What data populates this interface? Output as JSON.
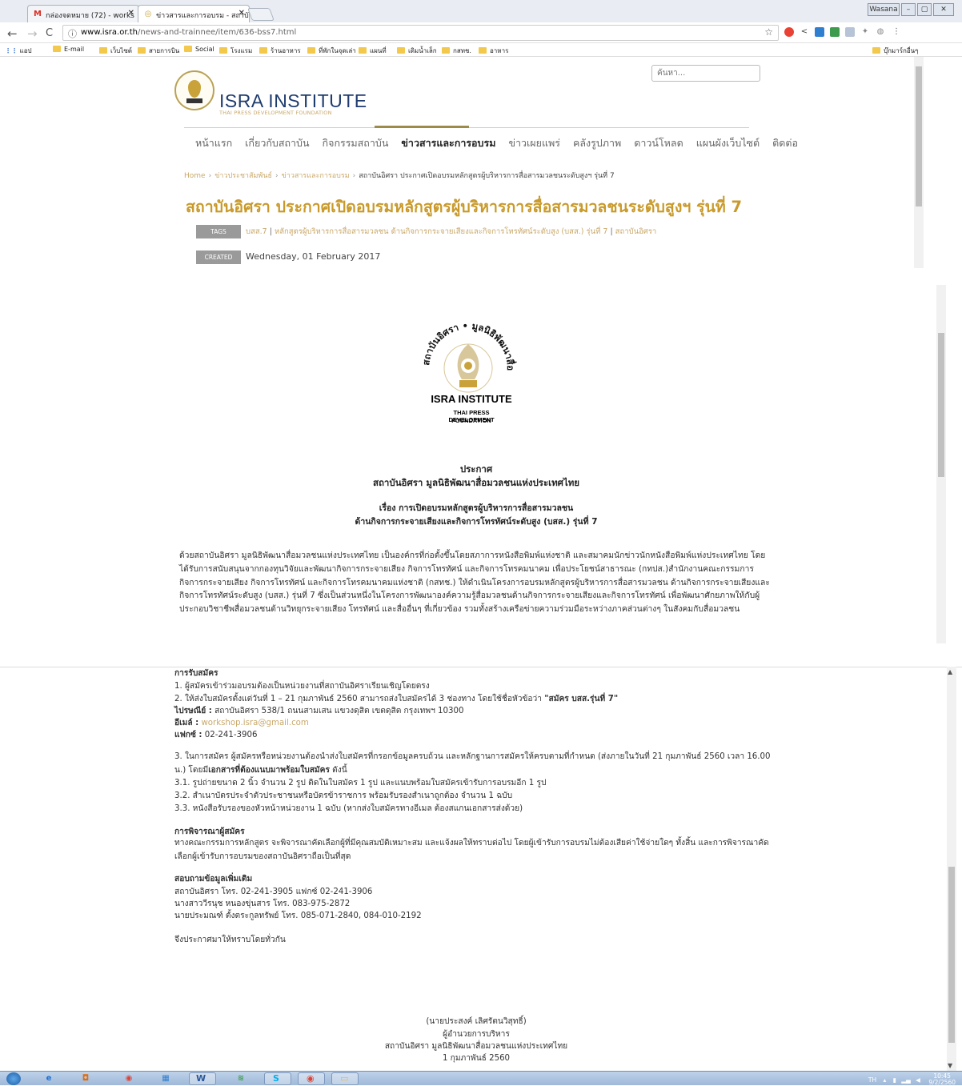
{
  "browser": {
    "tabs": [
      {
        "label": "กล่องจดหมาย (72) - works",
        "icon": "gmail-icon"
      },
      {
        "label": "ข่าวสารและการอบรม - สถาบั",
        "icon": "isra-favicon-icon"
      }
    ],
    "window_buttons": [
      "Wasana",
      "–",
      "▢",
      "✕"
    ],
    "url_host": "www.isra.or.th",
    "url_path": "/news-and-trainnee/item/636-bss7.html",
    "bookmarks": [
      "แอป",
      "E-mail",
      "เว็บไซต์",
      "สายการบิน",
      "Social",
      "โรงแรม",
      "ร้านอาหาร",
      "ที่พักในจุดเล่า",
      "แผนที่",
      "เดิมน้ำเล็ก",
      "กสทช.",
      "อาหาร"
    ],
    "bookmarks_right": "บุ๊กมาร์กอื่นๆ"
  },
  "site": {
    "search_placeholder": "ค้นหา...",
    "title": "ISRA INSTITUTE",
    "subtitle": "THAI PRESS DEVELOPMENT FOUNDATION",
    "nav": [
      "หน้าแรก",
      "เกี่ยวกับสถาบัน",
      "กิจกรรมสถาบัน",
      "ข่าวสารและการอบรม",
      "ข่าวเผยแพร่",
      "คลังรูปภาพ",
      "ดาวน์โหลด",
      "แผนผังเว็บไซต์",
      "ติดต่อ"
    ],
    "nav_active_index": 3
  },
  "breadcrumb": {
    "items": [
      "Home",
      "ข่าวประชาสัมพันธ์",
      "ข่าวสารและการอบรม"
    ],
    "current": "สถาบันอิศรา ประกาศเปิดอบรมหลักสูตรผู้บริหารการสื่อสารมวลชนระดับสูงฯ รุ่นที่ 7"
  },
  "article": {
    "title": "สถาบันอิศรา ประกาศเปิดอบรมหลักสูตรผู้บริหารการสื่อสารมวลชนระดับสูงฯ รุ่นที่ 7",
    "tags_label": "TAGS",
    "tags": [
      "บสส.7",
      "หลักสูตรผู้บริหารการสื่อสารมวลชน ด้านกิจการกระจายเสียงและกิจการโทรทัศน์ระดับสูง (บสส.) รุ่นที่ 7",
      "สถาบันอิศรา"
    ],
    "created_label": "CREATED",
    "created": "Wednesday, 01 February 2017",
    "logo": {
      "arc_text": "สถาบันอิศรา • มูลนิธิพัฒนาสื่อมวลชนแห่งประเทศไทย",
      "name": "ISRA INSTITUTE",
      "line1": "THAI PRESS DEVELOPMENT",
      "line2": "FOUNDATION"
    },
    "announce": {
      "heading": "ประกาศ",
      "org": "สถาบันอิศรา มูลนิธิพัฒนาสื่อมวลชนแห่งประเทศไทย",
      "subject1": "เรื่อง การเปิดอบรมหลักสูตรผู้บริหารการสื่อสารมวลชน",
      "subject2": "ด้านกิจการกระจายเสียงและกิจการโทรทัศน์ระดับสูง (บสส.) รุ่นที่ 7"
    },
    "intro": "ด้วยสถาบันอิศรา มูลนิธิพัฒนาสื่อมวลชนแห่งประเทศไทย เป็นองค์กรที่ก่อตั้งขึ้นโดยสภาการหนังสือพิมพ์แห่งชาติ และสมาคมนักข่าวนักหนังสือพิมพ์แห่งประเทศไทย โดยได้รับการสนับสนุนจากกองทุนวิจัยและพัฒนากิจการกระจายเสียง กิจการโทรทัศน์ และกิจการโทรคมนาคม เพื่อประโยชน์สาธารณะ (กทปส.)สำนักงานคณะกรรมการกิจการกระจายเสียง กิจการโทรทัศน์ และกิจการโทรคมนาคมแห่งชาติ (กสทช.) ให้ดำเนินโครงการอบรมหลักสูตรผู้บริหารการสื่อสารมวลชน ด้านกิจการกระจายเสียงและกิจการโทรทัศน์ระดับสูง (บสส.) รุ่นที่ 7 ซึ่งเป็นส่วนหนึ่งในโครงการพัฒนาองค์ความรู้สื่อมวลชนด้านกิจการกระจายเสียงและกิจการโทรทัศน์ เพื่อพัฒนาศักยภาพให้กับผู้ประกอบวิชาชีพสื่อมวลชนด้านวิทยุกระจายเสียง โทรทัศน์ และสื่ออื่นๆ ที่เกี่ยวข้อง รวมทั้งสร้างเครือข่ายความร่วมมือระหว่างภาคส่วนต่างๆ ในสังคมกับสื่อมวลชน",
    "apply": {
      "heading": "การรับสมัคร",
      "item1": "1. ผู้สมัครเข้าร่วมอบรมต้องเป็นหน่วยงานที่สถาบันอิศราเรียนเชิญโดยตรง",
      "item2": "2. ให้ส่งใบสมัครตั้งแต่วันที่ 1 – 21 กุมภาพันธ์ 2560 สามารถส่งใบสมัครได้ 3 ช่องทาง โดยใช้ชื่อหัวข้อว่า",
      "item2_strong": "\"สมัคร บสส.รุ่นที่ 7\"",
      "post_label": "ไปรษณีย์ :",
      "post": "สถาบันอิศรา 538/1 ถนนสามเสน แขวงดุสิต เขตดุสิต กรุงเทพฯ 10300",
      "email_label": "อีเมล์ :",
      "email": "workshop.isra@gmail.com",
      "fax_label": "แฟกซ์ :",
      "fax": "02-241-3906",
      "item3": "3. ในการสมัคร ผู้สมัครหรือหน่วยงานต้องนำส่งใบสมัครที่กรอกข้อมูลครบถ้วน และหลักฐานการสมัครให้ครบตามที่กำหนด (ส่งภายในวันที่ 21 กุมภาพันธ์ 2560 เวลา 16.00 น.) โดยมี",
      "item3_strong": "เอกสารที่ต้องแนบมาพร้อมใบสมัคร",
      "item3_tail": "ดังนี้",
      "item31": "3.1. รูปถ่ายขนาด 2 นิ้ว จำนวน 2 รูป ติดในใบสมัคร 1 รูป และแนบพร้อมใบสมัครเข้ารับการอบรมอีก 1 รูป",
      "item32": "3.2. สำเนาบัตรประจำตัวประชาชนหรือบัตรข้าราชการ พร้อมรับรองสำเนาถูกต้อง จำนวน 1 ฉบับ",
      "item33": "3.3. หนังสือรับรองของหัวหน้าหน่วยงาน 1 ฉบับ (หากส่งใบสมัครทางอีเมล ต้องสแกนเอกสารส่งด้วย)"
    },
    "consider": {
      "heading": "การพิจารณาผู้สมัคร",
      "text": "ทางคณะกรรมการหลักสูตร จะพิจารณาคัดเลือกผู้ที่มีคุณสมบัติเหมาะสม และแจ้งผลให้ทราบต่อไป โดยผู้เข้ารับการอบรมไม่ต้องเสียค่าใช้จ่ายใดๆ ทั้งสิ้น และการพิจารณาคัดเลือกผู้เข้ารับการอบรมของสถาบันอิศราถือเป็นที่สุด"
    },
    "contact": {
      "heading": "สอบถามข้อมูลเพิ่มเติม",
      "line1": "สถาบันอิศรา โทร. 02-241-3905 แฟกซ์ 02-241-3906",
      "line2": "นางสาววีรนุช หนองขุ่นสาร โทร. 083-975-2872",
      "line3": "นายประมณฑ์ ตั้งตระกูลทรัพย์ โทร. 085-071-2840, 084-010-2192"
    },
    "closing": "จึงประกาศมาให้ทราบโดยทั่วกัน",
    "signature": {
      "name": "(นายประสงค์ เลิศรัตนวิสุทธิ์)",
      "position": "ผู้อำนวยการบริหาร",
      "org": "สถาบันอิศรา มูลนิธิพัฒนาสื่อมวลชนแห่งประเทศไทย",
      "date": "1 กุมภาพันธ์ 2560"
    }
  },
  "taskbar": {
    "lang": "TH",
    "time": "10:45",
    "date": "9/2/2560"
  }
}
